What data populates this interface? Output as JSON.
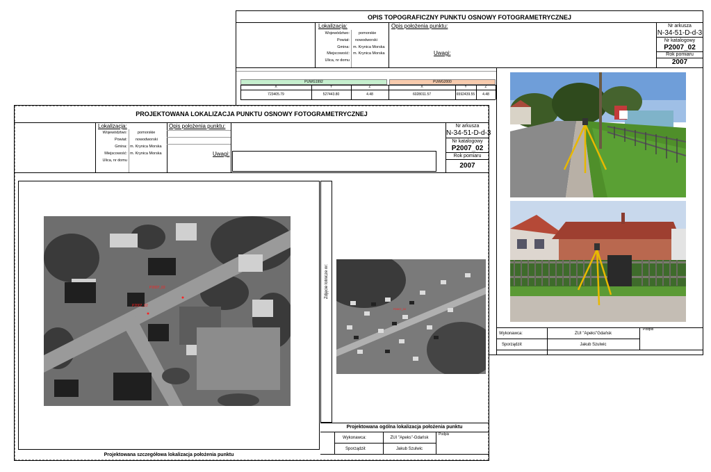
{
  "back_sheet": {
    "title": "OPIS TOPOGRAFICZNY PUNKTU OSNOWY FOTOGRAMETRYCZNEJ",
    "lokalizacja_label": "Lokalizacja:",
    "fields": [
      {
        "label": "Województwo:",
        "value": "pomorskie"
      },
      {
        "label": "Powiat:",
        "value": "nowodworski"
      },
      {
        "label": "Gmina:",
        "value": "m. Krynica Morska"
      },
      {
        "label": "Miejscowość:",
        "value": "m. Krynica Morska"
      },
      {
        "label": "Ulica, nr domu",
        "value": ""
      }
    ],
    "opis_label": "Opis położenia punktu:",
    "uwagi_label": "Uwagi:",
    "nr_arkusza_label": "Nr arkusza",
    "nr_arkusza": "N-34-51-D-d-3",
    "nr_katalogowy_label": "Nr katalogowy",
    "nr_katalogowy": "P2007_02",
    "rok_pomiaru_label": "Rok pomiaru",
    "rok_pomiaru": "2007",
    "coords": {
      "puwg1992": "PUWG1992",
      "puwg2000": "PUWG2000",
      "headers_1992": [
        "X",
        "Y",
        "Z"
      ],
      "headers_2000": [
        "X",
        "Y",
        "Z"
      ],
      "values_1992": [
        "723405.79",
        "527443.80",
        "4.48"
      ],
      "values_2000": [
        "6028011.57",
        "6592439.55",
        "4.48"
      ]
    },
    "wykonawca_label": "Wykonawca:",
    "wykonawca": "ZUI \"Apeks\"Gdańsk",
    "sporzadzil_label": "Sporządził:",
    "sporzadzil": "Jakub Szulwic",
    "podpis_label": "Podpis"
  },
  "front_sheet": {
    "title": "PROJEKTOWANA LOKALIZACJA PUNKTU OSNOWY FOTOGRAMETRYCZNEJ",
    "lokalizacja_label": "Lokalizacja:",
    "fields": [
      {
        "label": "Województwo:",
        "value": "pomorskie"
      },
      {
        "label": "Powiat:",
        "value": "nowodworski"
      },
      {
        "label": "Gmina:",
        "value": "m. Krynica Morska"
      },
      {
        "label": "Miejscowość:",
        "value": "m. Krynica Morska"
      },
      {
        "label": "Ulica, nr domu",
        "value": ""
      }
    ],
    "opis_label": "Opis położenia punktu:",
    "uwagi_label": "Uwagi:",
    "nr_arkusza_label": "Nr arkusza",
    "nr_arkusza": "N-34-51-D-d-3",
    "nr_katalogowy_label": "Nr katalogowy",
    "nr_katalogowy": "P2007_02",
    "rok_pomiaru_label": "Rok pomiaru",
    "rok_pomiaru": "2007",
    "zdjecie_label": "Zdjęcie lotnicze nr:",
    "szczegolowa_caption": "Projektowana szczegółowa lokalizacja położenia punktu",
    "ogolna_caption": "Projektowana ogólna lokalizacja położenia punktu",
    "wykonawca_label": "Wykonawca:",
    "wykonawca": "ZUI \"Apeks\"-Gdańsk",
    "sporzadzil_label": "Sporządził:",
    "sporzadzil": "Jakub Szulwic",
    "podpis_label": "Podpis",
    "map_label_1": "P2007_02",
    "map_label_2": "P2007_02",
    "map_label_3": "P2007_02"
  }
}
